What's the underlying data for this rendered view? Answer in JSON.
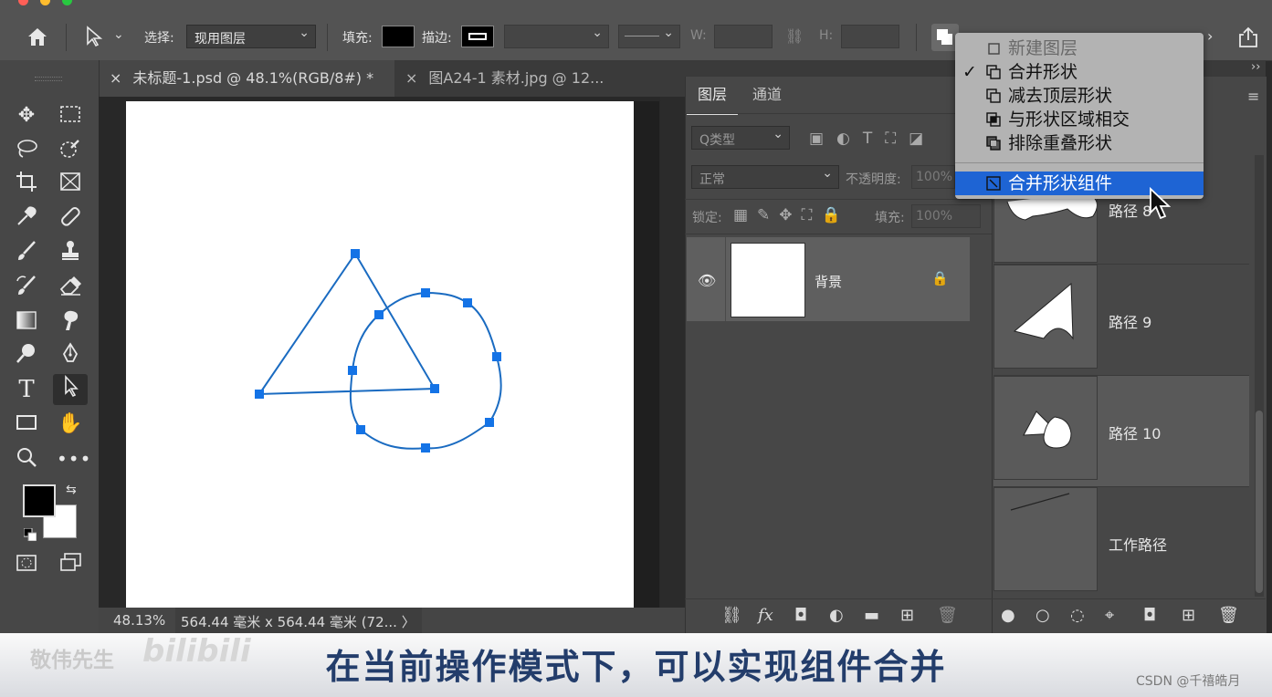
{
  "option_bar": {
    "home_icon": "home-icon",
    "tool_icon": "direct-selection-arrow-icon",
    "select_label": "选择:",
    "select_value": "现用图层",
    "fill_label": "填充:",
    "fill_color": "#000000",
    "stroke_label": "描边:",
    "w_label": "W:",
    "h_label": "H:"
  },
  "tabs": [
    {
      "label": "未标题-1.psd @ 48.1%(RGB/8#) *",
      "active": true
    },
    {
      "label": "图A24-1 素材.jpg @ 12...",
      "active": false
    }
  ],
  "status": {
    "zoom": "48.13%",
    "dimensions": "564.44 毫米 x 564.44 毫米 (72... 〉"
  },
  "layers_panel": {
    "tabs": [
      "图层",
      "通道"
    ],
    "filter_label": "Q类型",
    "blend_mode": "正常",
    "opacity_label": "不透明度:",
    "opacity_value": "100%",
    "lock_label": "锁定:",
    "fill_label": "填充:",
    "fill_value": "100%",
    "layers": [
      {
        "name": "背景",
        "visible": true,
        "locked": true
      }
    ]
  },
  "paths_panel": {
    "paths": [
      {
        "name": "路径 8"
      },
      {
        "name": "路径 9"
      },
      {
        "name": "路径 10"
      },
      {
        "name": "工作路径"
      }
    ]
  },
  "path_ops_menu": {
    "items": [
      {
        "label": "新建图层",
        "checked": false,
        "disabled": true
      },
      {
        "label": "合并形状",
        "checked": true,
        "disabled": false
      },
      {
        "label": "减去顶层形状",
        "checked": false,
        "disabled": false
      },
      {
        "label": "与形状区域相交",
        "checked": false,
        "disabled": false
      },
      {
        "label": "排除重叠形状",
        "checked": false,
        "disabled": false
      },
      {
        "label": "合并形状组件",
        "checked": false,
        "highlighted": true
      }
    ]
  },
  "banner": {
    "caption": "在当前操作模式下，可以实现组件合并",
    "watermark": "敬伟先生",
    "site_logo": "bilibili",
    "credit": "CSDN @千禧皓月"
  },
  "colors": {
    "accent": "#1473e6",
    "path_stroke": "#1a6bc1",
    "anchor": "#1473e6",
    "menu_highlight": "#1e64d4"
  }
}
